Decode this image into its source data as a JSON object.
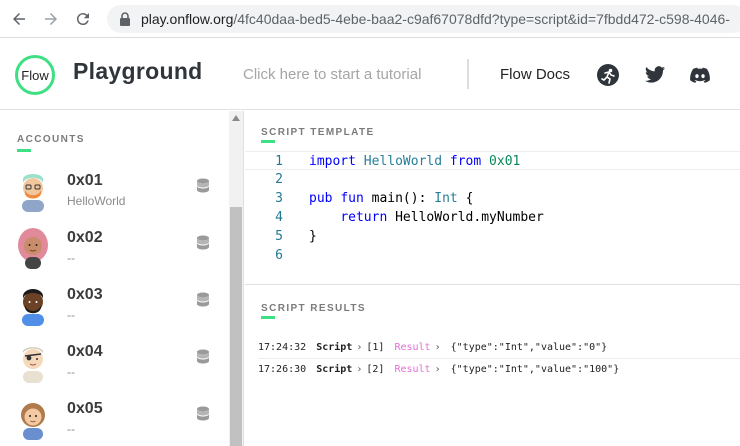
{
  "browser": {
    "url_host": "play.onflow.org",
    "url_path": "/4fc40daa-bed5-4ebe-baa2-c9af67078dfd?type=script&id=7fbdd472-c598-4046-"
  },
  "header": {
    "logo_text": "Flow",
    "brand": "Playground",
    "tutorial_link": "Click here to start a tutorial",
    "docs_link": "Flow Docs",
    "social_icons": [
      "gitcoin-icon",
      "twitter-icon",
      "discord-icon"
    ]
  },
  "sidebar": {
    "section_title": "ACCOUNTS",
    "accounts": [
      {
        "address": "0x01",
        "contract": "HelloWorld"
      },
      {
        "address": "0x02",
        "contract": "--"
      },
      {
        "address": "0x03",
        "contract": "--"
      },
      {
        "address": "0x04",
        "contract": "--"
      },
      {
        "address": "0x05",
        "contract": "--"
      }
    ]
  },
  "editor": {
    "section_title": "SCRIPT TEMPLATE",
    "line_numbers": [
      "1",
      "2",
      "3",
      "4",
      "5",
      "6"
    ],
    "code": {
      "l1_import": "import",
      "l1_name": "HelloWorld",
      "l1_from": "from",
      "l1_addr": "0x01",
      "l3_pub": "pub",
      "l3_fun": "fun",
      "l3_main": "main():",
      "l3_type": "Int",
      "l3_brace": "{",
      "l4_return": "return",
      "l4_expr": "HelloWorld.myNumber",
      "l5_close": "}"
    }
  },
  "results": {
    "section_title": "SCRIPT RESULTS",
    "rows": [
      {
        "time": "17:24:32",
        "kind": "Script",
        "index": "[1]",
        "label": "Result",
        "value": "{\"type\":\"Int\",\"value\":\"0\"}"
      },
      {
        "time": "17:26:30",
        "kind": "Script",
        "index": "[2]",
        "label": "Result",
        "value": "{\"type\":\"Int\",\"value\":\"100\"}"
      }
    ]
  },
  "colors": {
    "accent": "#3ee084",
    "result_label": "#e36fd3"
  }
}
